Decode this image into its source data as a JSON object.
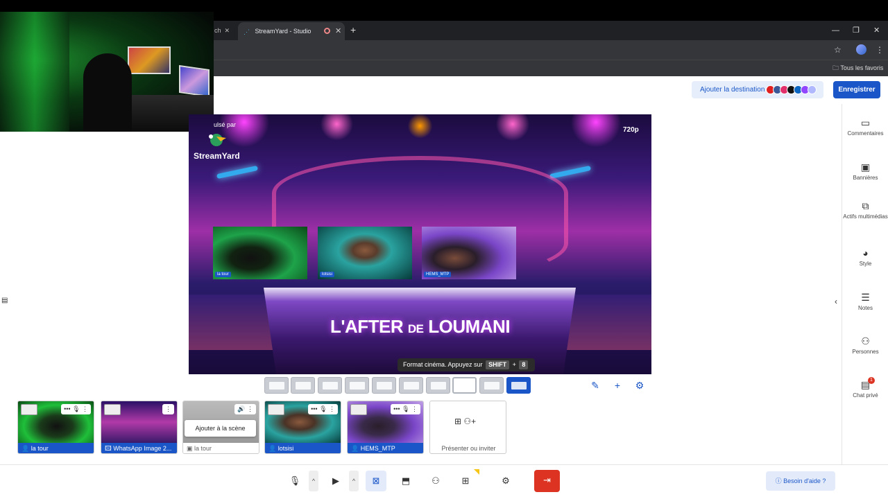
{
  "browser": {
    "tab_title": "StreamYard - Studio",
    "bookmarks_label": "Tous les favoris"
  },
  "header": {
    "add_destination_label": "Ajouter la destination",
    "record_label": "Enregistrer",
    "destination_colors": [
      "#e02020",
      "#3b5998",
      "#e1306c",
      "#111111",
      "#0a66c2",
      "#9146ff",
      "#b0b8ff"
    ]
  },
  "stage": {
    "powered_by": "ulsé par",
    "brand": "StreamYard",
    "resolution": "720p",
    "show_title_a": "L'AFTER ",
    "show_title_de": "DE",
    "show_title_b": " LOUMANI",
    "participants": [
      {
        "name": "la tour"
      },
      {
        "name": "lotsisi"
      },
      {
        "name": "HEMS_MTP"
      }
    ]
  },
  "tooltip": {
    "text": "Format cinéma. Appuyez sur",
    "key1": "SHIFT",
    "plus": "+",
    "key2": "8"
  },
  "right_rail": [
    {
      "icon": "comment-icon",
      "label": "Commentaires"
    },
    {
      "icon": "banner-icon",
      "label": "Bannières"
    },
    {
      "icon": "media-icon",
      "label": "Actifs multimédias"
    },
    {
      "icon": "palette-icon",
      "label": "Style"
    },
    {
      "icon": "notes-icon",
      "label": "Notes"
    },
    {
      "icon": "people-icon",
      "label": "Personnes"
    },
    {
      "icon": "chat-icon",
      "label": "Chat privé",
      "badge": "1"
    }
  ],
  "sources": [
    {
      "label": "la tour",
      "kind": "camera",
      "on_stage": true
    },
    {
      "label": "WhatsApp Image 2...",
      "kind": "image",
      "on_stage": true
    },
    {
      "label": "la tour",
      "kind": "screen",
      "on_stage": false,
      "tip": "Ajouter à la scène"
    },
    {
      "label": "lotsisi",
      "kind": "camera",
      "on_stage": true
    },
    {
      "label": "HEMS_MTP",
      "kind": "camera",
      "on_stage": true
    }
  ],
  "present_card": {
    "label": "Présenter ou inviter"
  },
  "bottom": {
    "help_label": "Besoin d'aide ?"
  },
  "colors": {
    "accent": "#1a56c7",
    "danger": "#dd3322"
  }
}
